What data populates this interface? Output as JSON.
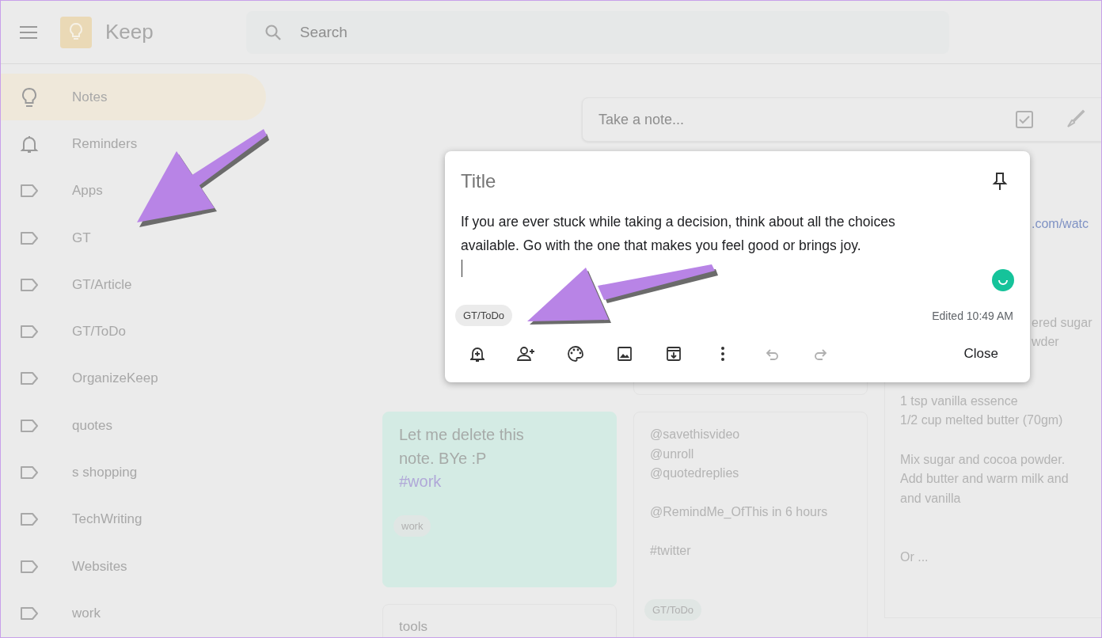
{
  "header": {
    "app_name": "Keep",
    "search": {
      "placeholder": "Search"
    }
  },
  "sidebar": {
    "items": [
      {
        "kind": "notes",
        "label": "Notes",
        "selected": true
      },
      {
        "kind": "reminders",
        "label": "Reminders",
        "selected": false
      },
      {
        "kind": "label",
        "label": "Apps",
        "selected": false
      },
      {
        "kind": "label",
        "label": "GT",
        "selected": false
      },
      {
        "kind": "label",
        "label": "GT/Article",
        "selected": false
      },
      {
        "kind": "label",
        "label": "GT/ToDo",
        "selected": false
      },
      {
        "kind": "label",
        "label": "OrganizeKeep",
        "selected": false
      },
      {
        "kind": "label",
        "label": "quotes",
        "selected": false
      },
      {
        "kind": "label",
        "label": "s shopping",
        "selected": false
      },
      {
        "kind": "label",
        "label": "TechWriting",
        "selected": false
      },
      {
        "kind": "label",
        "label": "Websites",
        "selected": false
      },
      {
        "kind": "label",
        "label": "work",
        "selected": false
      }
    ]
  },
  "take_note": {
    "placeholder": "Take a note..."
  },
  "notes": {
    "column_1": [
      {
        "color": "#d4ebe4",
        "big_lines": [
          "Let me delete this",
          "note. BYe :P"
        ],
        "hashtag": "#work",
        "label": "work"
      },
      {
        "color": "#ebebeb",
        "title": "tools"
      }
    ],
    "column_2": [
      {
        "color": "#ebebeb"
      },
      {
        "color": "#ebebeb",
        "paragraphs": [
          [
            "@savethisvideo",
            "@unroll",
            "@quotedreplies"
          ],
          [
            "@RemindMe_OfThis in 6 hours"
          ],
          [
            "#twitter"
          ]
        ],
        "label": "GT/ToDo"
      }
    ],
    "column_3": {
      "paragraphs": [
        {
          "kind": "link",
          "lines": [
            ".com/watc"
          ]
        },
        {
          "kind": "clipped",
          "lines": [
            "ered sugar",
            "wder"
          ]
        },
        {
          "kind": "text",
          "lines": [
            "1 tsp vanilla essence",
            "1/2 cup melted butter (70gm)"
          ]
        },
        {
          "kind": "text",
          "lines": [
            "Mix sugar and cocoa powder.",
            "Add butter and warm milk and",
            "and vanilla"
          ]
        },
        {
          "kind": "text",
          "lines": [
            "Or ..."
          ]
        }
      ]
    }
  },
  "editor": {
    "title_placeholder": "Title",
    "body": "If you are ever stuck while taking a decision, think about all the choices available. Go with the one that makes you feel good or brings joy.",
    "label": "GT/ToDo",
    "edited": "Edited 10:49 AM",
    "toolbar": [
      {
        "kind": "remind",
        "disabled": false
      },
      {
        "kind": "collaborator",
        "disabled": false
      },
      {
        "kind": "palette",
        "disabled": false
      },
      {
        "kind": "image",
        "disabled": false
      },
      {
        "kind": "archive",
        "disabled": false
      },
      {
        "kind": "more",
        "disabled": false
      },
      {
        "kind": "undo",
        "disabled": true
      },
      {
        "kind": "redo",
        "disabled": true
      }
    ],
    "close": "Close"
  }
}
